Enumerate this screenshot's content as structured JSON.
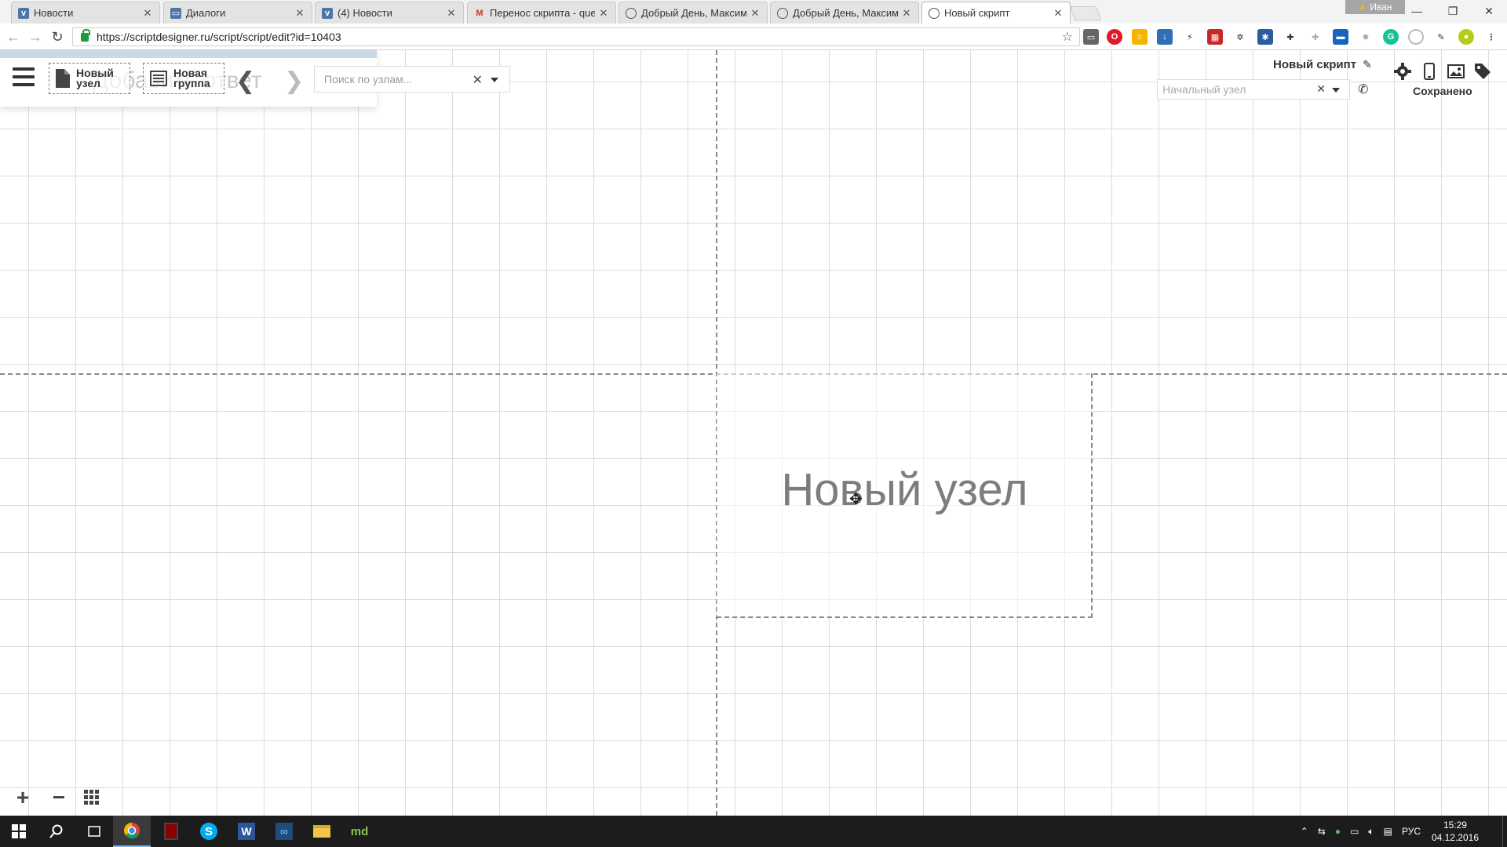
{
  "browser": {
    "tabs": [
      {
        "title": "Новости",
        "icon": "vk-icon",
        "color": "#4a76a8",
        "active": false
      },
      {
        "title": "Диалоги",
        "icon": "vk-messages-icon",
        "color": "#4a76a8",
        "active": false
      },
      {
        "title": "(4) Новости",
        "icon": "vk-icon",
        "color": "#4a76a8",
        "active": false
      },
      {
        "title": "Перенос скрипта - que!",
        "icon": "gmail-icon",
        "color": "#d93025",
        "active": false
      },
      {
        "title": "Добрый День, Максим!",
        "icon": "whatsapp-icon",
        "color": "#555555",
        "active": false
      },
      {
        "title": "Добрый День, Максим!",
        "icon": "whatsapp-icon",
        "color": "#555555",
        "active": false
      },
      {
        "title": "Новый скрипт",
        "icon": "whatsapp-icon",
        "color": "#555555",
        "active": true
      }
    ],
    "user": "Иван",
    "url": "https://scriptdesigner.ru/script/script/edit?id=10403"
  },
  "editor": {
    "ghost_text": "Добавить ответ",
    "new_node_label": "Новый\nузел",
    "new_group_label": "Новая\nгруппа",
    "search_placeholder": "Поиск по узлам...",
    "script_name": "Новый скрипт",
    "start_node_placeholder": "Начальный узел",
    "saved_status": "Сохранено"
  },
  "canvas": {
    "node_title": "Новый узел"
  },
  "taskbar": {
    "language": "РУС",
    "time": "15:29",
    "date": "04.12.2016"
  },
  "colors": {
    "grid": "#dcdcdc",
    "guide": "#8a8a8a",
    "panel_strip": "#cbd9e5",
    "taskbar": "#1c1c1c"
  }
}
